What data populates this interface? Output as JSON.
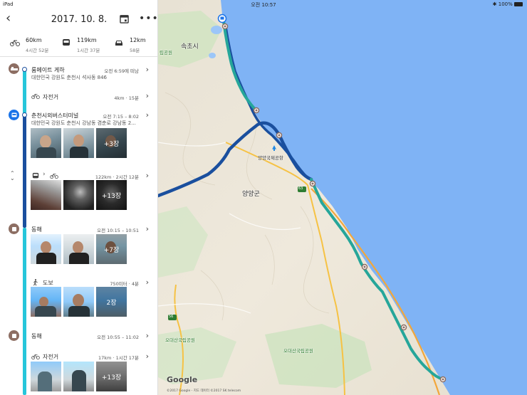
{
  "status": {
    "device": "iPad",
    "time": "오전 10:57",
    "battery": "100%"
  },
  "header": {
    "date": "2017. 10. 8."
  },
  "summary": [
    {
      "icon": "bicycle-icon",
      "value": "60km",
      "sub": "4시간 52분"
    },
    {
      "icon": "bus-icon",
      "value": "119km",
      "sub": "1시간 37분"
    },
    {
      "icon": "car-icon",
      "value": "12km",
      "sub": "58분"
    }
  ],
  "timeline": {
    "place1": {
      "title": "룸메이트 게하",
      "time": "오전 6:59에 떠남",
      "address": "대한민국 강원도 춘천시 석사동 846"
    },
    "act1": {
      "label": "자전거",
      "meta": "4km · 15분"
    },
    "place2": {
      "title": "춘천시외버스터미널",
      "time": "오전 7:15 – 8:02",
      "address": "대한민국 강원도 춘천시 강남동 겸춘로 강남동 2...",
      "more_photos": "+3장"
    },
    "act2": {
      "meta": "122km · 2시간 12분",
      "more_photos": "+13장"
    },
    "place3": {
      "title": "동해",
      "time": "오전 10:15 – 10:51",
      "more_photos": "+7장"
    },
    "act3": {
      "label": "도보",
      "meta": "750미터 · 4분",
      "more_photos": "2장"
    },
    "place4": {
      "title": "동해",
      "time": "오전 10:55 – 11:02"
    },
    "act4": {
      "label": "자전거",
      "meta": "17km · 1시간 17분",
      "more_photos": "+13장"
    }
  },
  "map": {
    "labels": {
      "sokcho": "속초시",
      "park_top": "립공원",
      "airport": "양양국제공항",
      "yangyang": "양양군",
      "road56": "56",
      "road63": "63",
      "odae1": "오대산국립공원",
      "odae2": "오대산국립공원"
    },
    "google": "Google",
    "copyright": "©2017 Google - 지도 데이터 ©2017 SK telecom"
  },
  "colors": {
    "bus_route": "#1a4f9e",
    "bike_route": "#26a69a",
    "sea": "#7fb3f5"
  }
}
